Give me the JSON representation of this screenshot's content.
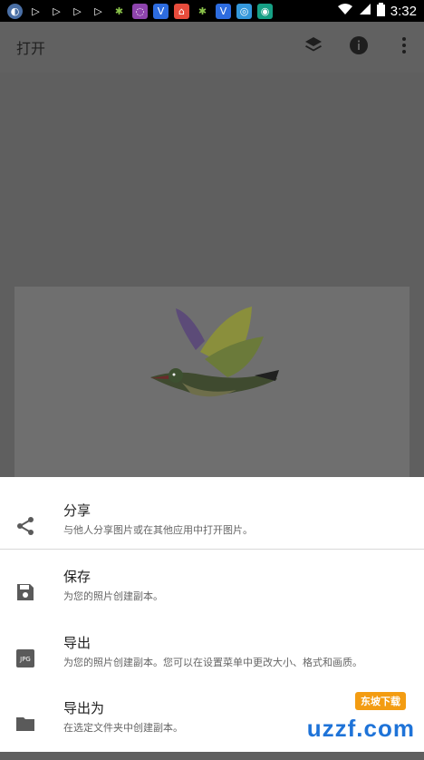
{
  "status_bar": {
    "time": "3:32",
    "icons": [
      "app-icon-1",
      "play-icon-1",
      "play-icon-2",
      "play-icon-3",
      "play-icon-4",
      "android-icon-1",
      "app-icon-2",
      "app-icon-3",
      "app-icon-4",
      "android-icon-2",
      "app-icon-5",
      "app-icon-6",
      "app-icon-7",
      "wifi-icon",
      "signal-icon",
      "battery-icon"
    ]
  },
  "app_bar": {
    "title": "打开",
    "actions": [
      "layers-icon",
      "info-icon",
      "more-vert-icon"
    ]
  },
  "sheet": {
    "items": [
      {
        "title": "分享",
        "desc": "与他人分享图片或在其他应用中打开图片。",
        "icon": "share-icon"
      },
      {
        "title": "保存",
        "desc": "为您的照片创建副本。",
        "icon": "save-icon"
      },
      {
        "title": "导出",
        "desc": "为您的照片创建副本。您可以在设置菜单中更改大小、格式和画质。",
        "icon": "jpg-icon"
      },
      {
        "title": "导出为",
        "desc": "在选定文件夹中创建副本。",
        "icon": "folder-icon"
      }
    ]
  },
  "watermark": {
    "text": "uzzf.com",
    "badge": "东坡下载"
  }
}
